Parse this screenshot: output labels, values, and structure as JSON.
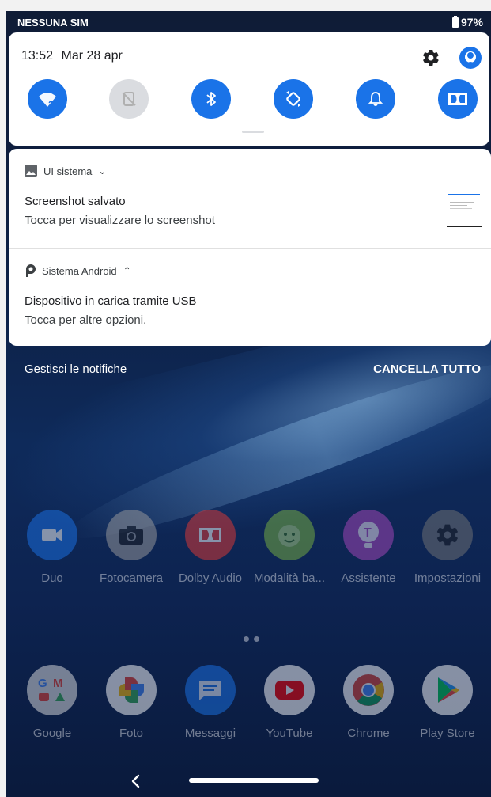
{
  "status_bar": {
    "carrier": "NESSUNA SIM",
    "battery": "97%"
  },
  "quick_settings": {
    "time": "13:52",
    "date": "Mar 28 apr",
    "tiles": [
      {
        "name": "wifi",
        "icon": "wifi-question-icon",
        "state": "on"
      },
      {
        "name": "mobile-data",
        "icon": "no-sim-icon",
        "state": "off"
      },
      {
        "name": "bluetooth",
        "icon": "bluetooth-icon",
        "state": "on"
      },
      {
        "name": "auto-rotate",
        "icon": "rotate-icon",
        "state": "on"
      },
      {
        "name": "sound",
        "icon": "bell-icon",
        "state": "on"
      },
      {
        "name": "dolby",
        "icon": "dolby-icon",
        "state": "on"
      }
    ],
    "colors": {
      "active": "#1a73e8",
      "inactive": "#dadce0"
    }
  },
  "notifications": [
    {
      "app": "UI sistema",
      "expand_glyph": "⌄",
      "title": "Screenshot salvato",
      "text": "Tocca per visualizzare lo screenshot"
    },
    {
      "app": "Sistema Android",
      "expand_glyph": "⌃",
      "title": "Dispositivo in carica tramite USB",
      "text": "Tocca per altre opzioni."
    }
  ],
  "actions": {
    "manage": "Gestisci le notifiche",
    "clear_all": "CANCELLA TUTTO"
  },
  "apps_row1": [
    {
      "label": "Duo",
      "icon": "duo-icon",
      "color": "#1a73e8"
    },
    {
      "label": "Fotocamera",
      "icon": "camera-icon",
      "color": "#9e9e9e"
    },
    {
      "label": "Dolby Audio",
      "icon": "dolby-icon",
      "color": "#e53935"
    },
    {
      "label": "Modalità ba...",
      "icon": "kids-mode-icon",
      "color": "#7cb342"
    },
    {
      "label": "Assistente",
      "icon": "assistant-icon",
      "color": "#ab47bc"
    },
    {
      "label": "Impostazioni",
      "icon": "settings-icon",
      "color": "#757575"
    }
  ],
  "apps_row2": [
    {
      "label": "Google",
      "icon": "google-folder-icon",
      "color": "#e0e0e0"
    },
    {
      "label": "Foto",
      "icon": "photos-icon",
      "color": "#ffffff"
    },
    {
      "label": "Messaggi",
      "icon": "messages-icon",
      "color": "#1a73e8"
    },
    {
      "label": "YouTube",
      "icon": "youtube-icon",
      "color": "#ffffff"
    },
    {
      "label": "Chrome",
      "icon": "chrome-icon",
      "color": "#ffffff"
    },
    {
      "label": "Play Store",
      "icon": "play-store-icon",
      "color": "#ffffff"
    }
  ]
}
